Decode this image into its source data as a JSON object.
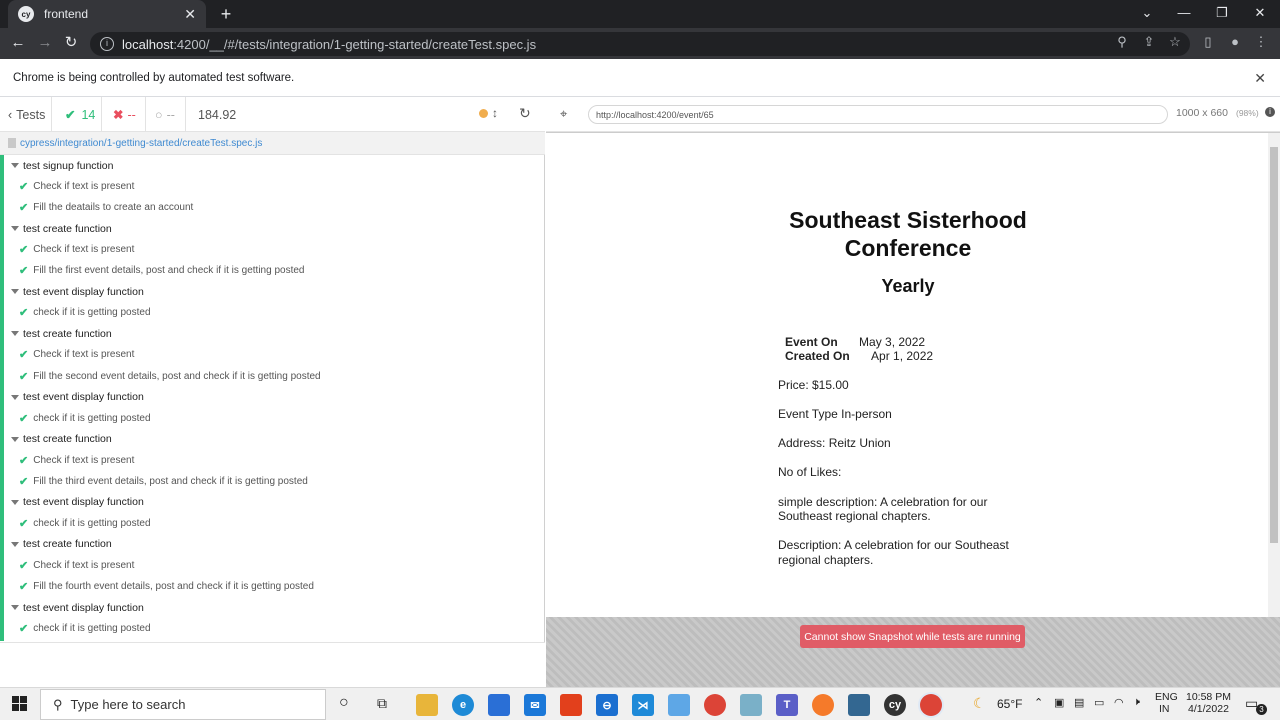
{
  "browser": {
    "tab_title": "frontend",
    "tab_favicon": "cy",
    "new_tab": "+",
    "url_host": "localhost",
    "url_rest": ":4200/__/#/tests/integration/1-getting-started/createTest.spec.js",
    "infobar_text": "Chrome is being controlled by automated test software."
  },
  "reporter": {
    "back_label": "Tests",
    "passed": "14",
    "failed": "--",
    "pending": "--",
    "duration": "184.92",
    "spec_path": "cypress/integration/1-getting-started/createTest.spec.js",
    "rows": [
      {
        "kind": "suite",
        "label": "test signup function"
      },
      {
        "kind": "test",
        "label": "Check if text is present"
      },
      {
        "kind": "test",
        "label": "Fill the deatails to create an account"
      },
      {
        "kind": "suite",
        "label": "test create function"
      },
      {
        "kind": "test",
        "label": "Check if text is present"
      },
      {
        "kind": "test",
        "label": "Fill the first event details, post and check if it is getting posted"
      },
      {
        "kind": "suite",
        "label": "test event display function"
      },
      {
        "kind": "test",
        "label": "check if it is getting posted"
      },
      {
        "kind": "suite",
        "label": "test create function"
      },
      {
        "kind": "test",
        "label": "Check if text is present"
      },
      {
        "kind": "test",
        "label": "Fill the second event details, post and check if it is getting posted"
      },
      {
        "kind": "suite",
        "label": "test event display function"
      },
      {
        "kind": "test",
        "label": "check if it is getting posted"
      },
      {
        "kind": "suite",
        "label": "test create function"
      },
      {
        "kind": "test",
        "label": "Check if text is present"
      },
      {
        "kind": "test",
        "label": "Fill the third event details, post and check if it is getting posted"
      },
      {
        "kind": "suite",
        "label": "test event display function"
      },
      {
        "kind": "test",
        "label": "check if it is getting posted"
      },
      {
        "kind": "suite",
        "label": "test create function"
      },
      {
        "kind": "test",
        "label": "Check if text is present"
      },
      {
        "kind": "test",
        "label": "Fill the fourth event details, post and check if it is getting posted"
      },
      {
        "kind": "suite",
        "label": "test event display function"
      },
      {
        "kind": "test",
        "label": "check if it is getting posted"
      }
    ]
  },
  "aut": {
    "url": "http://localhost:4200/event/65",
    "viewport_size": "1000 x 660",
    "scale": "(98%)",
    "snapshot_msg": "Cannot show Snapshot while tests are running"
  },
  "event": {
    "title": "Southeast Sisterhood Conference",
    "subtitle": "Yearly",
    "event_on_label": "Event On",
    "event_on_value": "May 3, 2022",
    "created_on_label": "Created On",
    "created_on_value": "Apr 1, 2022",
    "price": "Price: $15.00",
    "event_type": "Event Type In-person",
    "address": "Address: Reitz Union",
    "likes": "No of Likes:",
    "simple_desc_1": "simple description: A celebration for our",
    "simple_desc_2": "Southeast regional chapters.",
    "desc_1": "Description: A celebration for our Southeast",
    "desc_2": "regional chapters."
  },
  "taskbar": {
    "search_placeholder": "Type here to search",
    "weather": "65°F",
    "lang_1": "ENG",
    "lang_2": "IN",
    "time": "10:58 PM",
    "date": "4/1/2022",
    "notif_count": "3"
  },
  "colors": {
    "pass": "#2fbe7b",
    "fail": "#e94f5f",
    "running": "#f0ad4e",
    "link": "#3f8ad1",
    "snapshot": "#e05c66"
  }
}
